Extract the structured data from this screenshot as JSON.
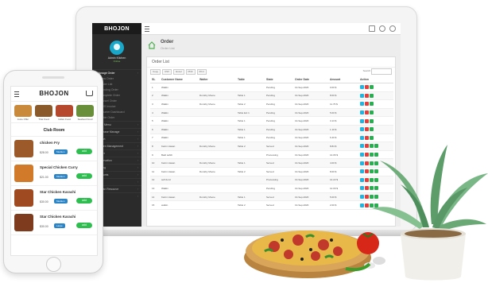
{
  "laptop": {
    "sidebar": {
      "logo": "BHOJON",
      "user": "Admin Kitchen",
      "status": "Online",
      "items": [
        {
          "label": "Manage Order",
          "active": true
        },
        {
          "label": "New Order",
          "sub": true
        },
        {
          "label": "Order List",
          "sub": true
        },
        {
          "label": "Pending Order",
          "sub": true
        },
        {
          "label": "Complete Order",
          "sub": true
        },
        {
          "label": "Cancel Order",
          "sub": true
        },
        {
          "label": "POS Invoice",
          "sub": true
        },
        {
          "label": "Counter Dashboard",
          "sub": true
        },
        {
          "label": "Table Order",
          "sub": true
        },
        {
          "label": "Food Menu"
        },
        {
          "label": "Purchase Manage"
        },
        {
          "label": "Report"
        },
        {
          "label": "Kitchen Management"
        },
        {
          "label": "Waiter"
        },
        {
          "label": "Reservation"
        },
        {
          "label": "Setting"
        },
        {
          "label": "Accounts"
        },
        {
          "label": "HRM"
        },
        {
          "label": "Human Resource"
        },
        {
          "label": "Tax"
        }
      ]
    },
    "page": {
      "title": "Order",
      "subtitle": "Order List"
    },
    "panel_title": "Order List",
    "tools": [
      "Copy",
      "CSV",
      "Excel",
      "PDF",
      "Print"
    ],
    "search_label": "Search:",
    "columns": [
      "SL",
      "Customer Name",
      "Waiter",
      "Table",
      "State",
      "Order Date",
      "Amount",
      "Action"
    ],
    "rows": [
      [
        "1",
        "Walkin",
        "",
        "",
        "Pending",
        "13-Sep-2020",
        "0.00 $",
        "b3"
      ],
      [
        "2",
        "Walkin",
        "Dorothy Moore",
        "Table 1",
        "Pending",
        "13-Sep-2020",
        "8.00 $",
        "b3"
      ],
      [
        "3",
        "Walkin",
        "Dorothy Moore",
        "Table 2",
        "Pending",
        "13-Sep-2020",
        "11.76 $",
        "b3"
      ],
      [
        "4",
        "Walkin",
        "",
        "Table Ext 1",
        "Pending",
        "13-Sep-2020",
        "5.00 $",
        "b3"
      ],
      [
        "5",
        "Walkin",
        "",
        "Table 1",
        "Pending",
        "13-Sep-2020",
        "3.13 $",
        "b3"
      ],
      [
        "6",
        "Walkin",
        "",
        "Table 1",
        "Pending",
        "13-Sep-2020",
        "1.10 $",
        "b3"
      ],
      [
        "7",
        "Walkin",
        "",
        "Table 1",
        "Pending",
        "13-Sep-2020",
        "6.40 $",
        "b3"
      ],
      [
        "8",
        "Karim Hasan",
        "Dorothy Moore",
        "Table 2",
        "Served",
        "13-Sep-2020",
        "8.84 $",
        "b4"
      ],
      [
        "9",
        "Badi sahib",
        "",
        "",
        "Processing",
        "13-Sep-2020",
        "14.06 $",
        "b4"
      ],
      [
        "10",
        "Karim Hasan",
        "Dorothy Moore",
        "Table 1",
        "Served",
        "13-Sep-2020",
        "4.00 $",
        "b4"
      ],
      [
        "11",
        "Karim Hasan",
        "Dorothy Moore",
        "Table 2",
        "Served",
        "13-Sep-2020",
        "8.00 $",
        "b4"
      ],
      [
        "12",
        "self dord",
        "",
        "",
        "Processing",
        "13-Sep-2020",
        "14.22 $",
        "b4"
      ],
      [
        "13",
        "Walkin",
        "",
        "",
        "Pending",
        "13-Sep-2020",
        "12.00 $",
        "b4"
      ],
      [
        "14",
        "Karim Hasan",
        "Dorothy Moore",
        "Table 1",
        "Served",
        "13-Sep-2020",
        "5.00 $",
        "b4"
      ],
      [
        "15",
        "walkin",
        "",
        "Table 2",
        "Served",
        "13-Sep-2020",
        "2.00 $",
        "b4"
      ]
    ]
  },
  "phone": {
    "logo": "BHOJON",
    "categories": [
      {
        "label": "Juice Offer",
        "color": "#c98a3b"
      },
      {
        "label": "Thai Food",
        "color": "#8b5a2b"
      },
      {
        "label": "Indian Food",
        "color": "#b5482d"
      },
      {
        "label": "Seafood Food",
        "color": "#6a8f3a"
      }
    ],
    "section_title": "Club Room",
    "items": [
      {
        "name": "chicken Fry",
        "price": "$28.00",
        "size": "Medium",
        "add": "add",
        "color": "#9c5a2a"
      },
      {
        "name": "Special Chicken Curry",
        "price": "$21.00",
        "size": "Medium",
        "add": "add",
        "color": "#d07a2a"
      },
      {
        "name": "Star Chicken Karachi",
        "price": "$30.00",
        "size": "Medium",
        "add": "add",
        "color": "#a04a22"
      },
      {
        "name": "Star Chicken Karachi",
        "price": "$30.00",
        "size": "Large",
        "add": "add",
        "color": "#7f3b1d"
      }
    ]
  },
  "colors": {
    "accent_green": "#27ae4f",
    "accent_cyan": "#1fb5e0",
    "accent_red": "#e53c3c",
    "sidebar_dark": "#2b2b2b"
  }
}
